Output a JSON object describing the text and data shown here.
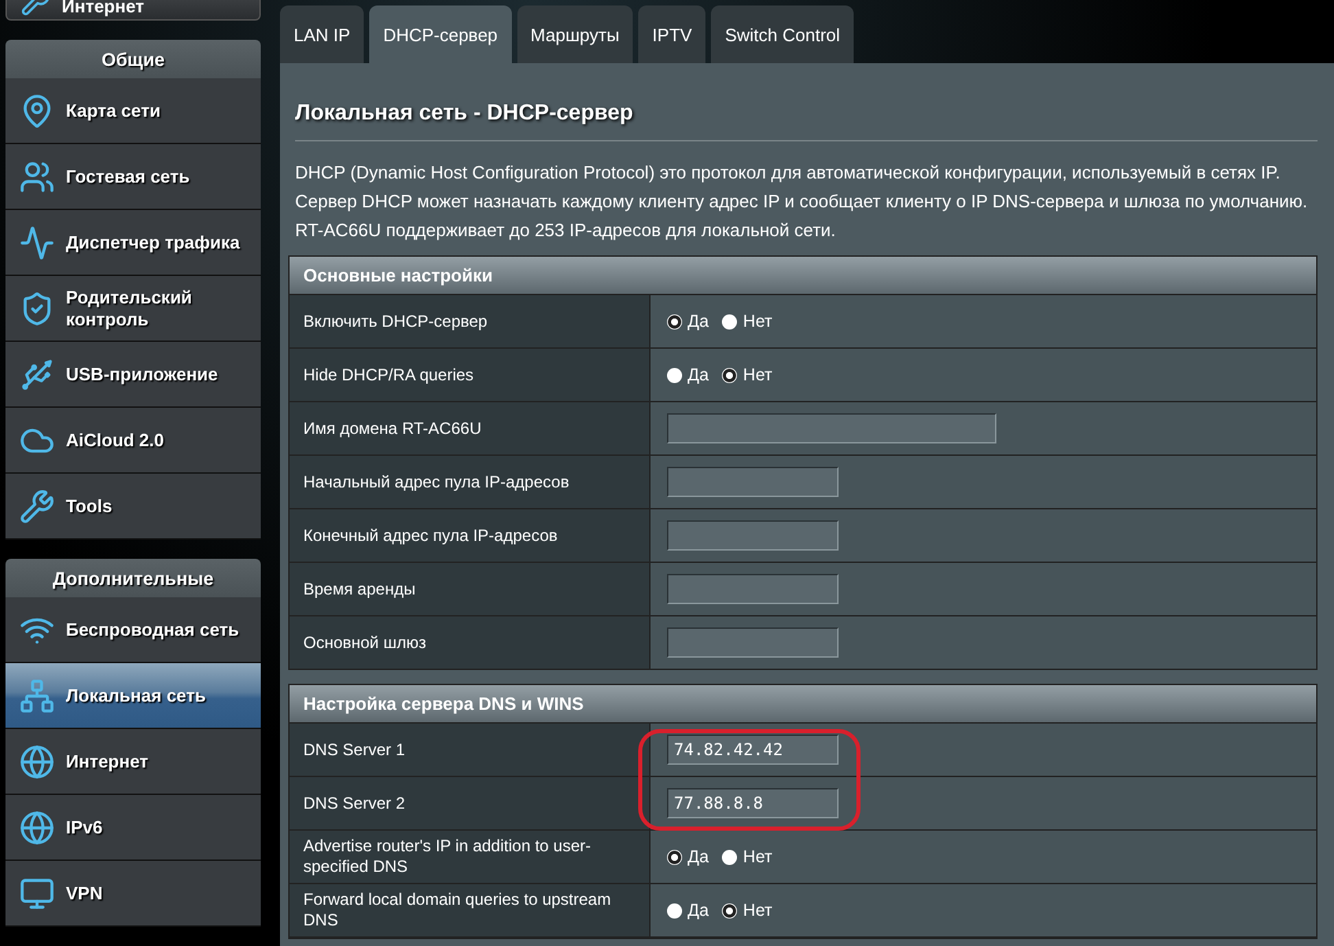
{
  "sidebar": {
    "top_item": {
      "label": "Интернет"
    },
    "sections": [
      {
        "title": "Общие",
        "items": [
          {
            "label": "Карта сети",
            "selected": false
          },
          {
            "label": "Гостевая сеть",
            "selected": false
          },
          {
            "label": "Диспетчер трафика",
            "selected": false
          },
          {
            "label": "Родительский контроль",
            "selected": false
          },
          {
            "label": "USB-приложение",
            "selected": false
          },
          {
            "label": "AiCloud 2.0",
            "selected": false
          },
          {
            "label": "Tools",
            "selected": false
          }
        ]
      },
      {
        "title": "Дополнительные",
        "items": [
          {
            "label": "Беспроводная сеть",
            "selected": false
          },
          {
            "label": "Локальная сеть",
            "selected": true
          },
          {
            "label": "Интернет",
            "selected": false
          },
          {
            "label": "IPv6",
            "selected": false
          },
          {
            "label": "VPN",
            "selected": false
          }
        ]
      }
    ]
  },
  "tabs": [
    {
      "label": "LAN IP",
      "selected": false
    },
    {
      "label": "DHCP-сервер",
      "selected": true
    },
    {
      "label": "Маршруты",
      "selected": false
    },
    {
      "label": "IPTV",
      "selected": false
    },
    {
      "label": "Switch Control",
      "selected": false
    }
  ],
  "page_title": "Локальная сеть - DHCP-сервер",
  "description": [
    "DHCP (Dynamic Host Configuration Protocol) это протокол для автоматической конфигурации, используемый в сетях IP.",
    "Сервер DHCP может назначать каждому клиенту адрес IP и сообщает клиенту о IP DNS-сервера и шлюза по умолчанию.",
    "RT-AC66U поддерживает до 253 IP-адресов для локальной сети."
  ],
  "sections": [
    {
      "title": "Основные настройки",
      "highlighted": false,
      "rows": [
        {
          "kind": "radio",
          "label": "Включить DHCP-сервер",
          "options": [
            {
              "label": "Да",
              "selected": true
            },
            {
              "label": "Нет",
              "selected": false
            }
          ]
        },
        {
          "kind": "radio",
          "label": "Hide DHCP/RA queries",
          "options": [
            {
              "label": "Да",
              "selected": false
            },
            {
              "label": "Нет",
              "selected": true
            }
          ]
        },
        {
          "kind": "wide_input",
          "label": "Имя домена RT-AC66U"
        },
        {
          "kind": "input",
          "label": "Начальный адрес пула IP-адресов"
        },
        {
          "kind": "input",
          "label": "Конечный адрес пула IP-адресов"
        },
        {
          "kind": "input",
          "label": "Время аренды"
        },
        {
          "kind": "input",
          "label": "Основной шлюз"
        }
      ]
    },
    {
      "title": "Настройка сервера DNS и WINS",
      "highlighted": true,
      "rows": [
        {
          "kind": "input",
          "label": "DNS Server 1",
          "value": "74.82.42.42"
        },
        {
          "kind": "input",
          "label": "DNS Server 2",
          "value": "77.88.8.8"
        },
        {
          "kind": "radio",
          "label": "Advertise router's IP in addition to user-specified DNS",
          "options": [
            {
              "label": "Да",
              "selected": true
            },
            {
              "label": "Нет",
              "selected": false
            }
          ]
        },
        {
          "kind": "radio",
          "label": "Forward local domain queries to upstream DNS",
          "options": [
            {
              "label": "Да",
              "selected": false
            },
            {
              "label": "Нет",
              "selected": true
            }
          ]
        }
      ]
    }
  ]
}
